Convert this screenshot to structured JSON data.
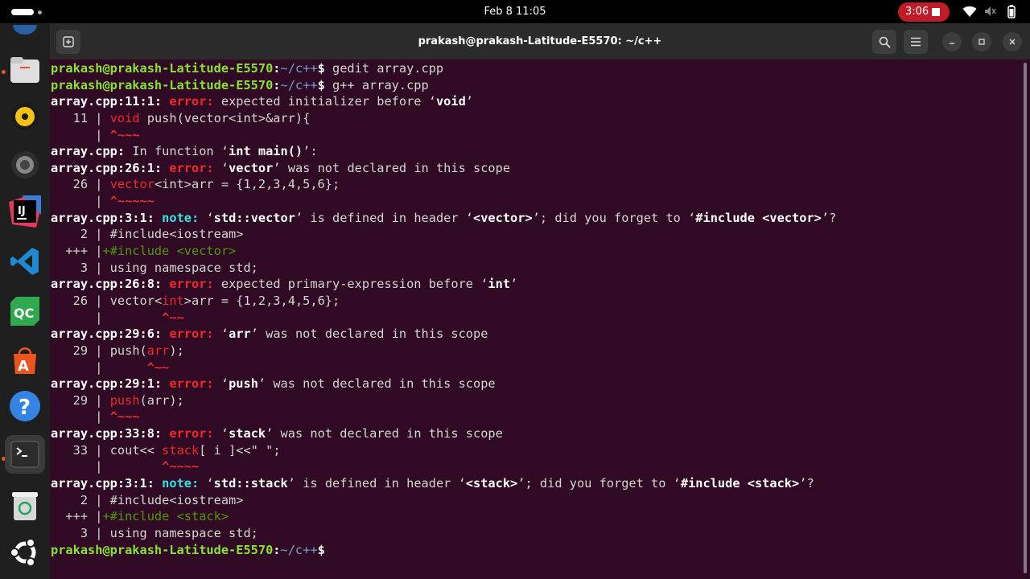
{
  "topbar": {
    "datetime": "Feb 8  11:05",
    "recording_time": "3:06"
  },
  "dock": {
    "items": [
      "files",
      "rhythmbox",
      "settings",
      "intellij",
      "vscode",
      "qt-creator",
      "app-center",
      "help",
      "terminal",
      "trash",
      "ubuntu-apps"
    ]
  },
  "window": {
    "title": "prakash@prakash-Latitude-E5570: ~/c++"
  },
  "terminal": {
    "prompt_user": "prakash@prakash-Latitude-E5570",
    "prompt_path": "~/c++",
    "cmd1": "gedit array.cpp",
    "cmd2": "g++ array.cpp",
    "lines": {
      "l3_loc": "array.cpp:11:1:",
      "l3_kind": "error:",
      "l3_msg_a": "expected initializer before ‘",
      "l3_tok": "void",
      "l3_msg_b": "’",
      "l4_num": "   11 | ",
      "l4_kw": "void",
      "l4_rest": " push(vector<int>&arr){",
      "l5_bar": "      | ",
      "l5_caret": "^~~~",
      "l6_a": "array.cpp:",
      "l6_b": " In function ‘",
      "l6_tok": "int main()",
      "l6_c": "’:",
      "l7_loc": "array.cpp:26:1:",
      "l7_kind": "error:",
      "l7_a": "‘",
      "l7_tok": "vector",
      "l7_b": "’ was not declared in this scope",
      "l8_num": "   26 | ",
      "l8_kw": "vector",
      "l8_rest": "<int>arr = {1,2,3,4,5,6};",
      "l9_bar": "      | ",
      "l9_caret": "^~~~~~",
      "l10_loc": "array.cpp:3:1:",
      "l10_kind": "note:",
      "l10_a": "‘",
      "l10_tok1": "std::vector",
      "l10_b": "’ is defined in header ‘",
      "l10_tok2": "<vector>",
      "l10_c": "’; did you forget to ‘",
      "l10_tok3": "#include <vector>",
      "l10_d": "’?",
      "l11": "    2 | #include<iostream>",
      "l12_num": "  +++ |",
      "l12_plus": "+#include <vector>",
      "l13": "    3 | using namespace std;",
      "l14_loc": "array.cpp:26:8:",
      "l14_kind": "error:",
      "l14_a": "expected primary-expression before ‘",
      "l14_tok": "int",
      "l14_b": "’",
      "l15_num": "   26 | ",
      "l15_a": "vector<",
      "l15_kw": "int",
      "l15_b": ">arr = {1,2,3,4,5,6};",
      "l16_bar": "      | ",
      "l16_sp": "       ",
      "l16_caret": "^~~",
      "l17_loc": "array.cpp:29:6:",
      "l17_kind": "error:",
      "l17_a": "‘",
      "l17_tok": "arr",
      "l17_b": "’ was not declared in this scope",
      "l18_num": "   29 | ",
      "l18_a": "push(",
      "l18_kw": "arr",
      "l18_b": ");",
      "l19_bar": "      | ",
      "l19_sp": "     ",
      "l19_caret": "^~~",
      "l20_loc": "array.cpp:29:1:",
      "l20_kind": "error:",
      "l20_a": "‘",
      "l20_tok": "push",
      "l20_b": "’ was not declared in this scope",
      "l21_num": "   29 | ",
      "l21_kw": "push",
      "l21_rest": "(arr);",
      "l22_bar": "      | ",
      "l22_caret": "^~~~",
      "l23_loc": "array.cpp:33:8:",
      "l23_kind": "error:",
      "l23_a": "‘",
      "l23_tok": "stack",
      "l23_b": "’ was not declared in this scope",
      "l24_num": "   33 | ",
      "l24_a": "cout<< ",
      "l24_kw": "stack",
      "l24_b": "[ i ]<<\" \";",
      "l25_bar": "      | ",
      "l25_sp": "       ",
      "l25_caret": "^~~~~",
      "l26_loc": "array.cpp:3:1:",
      "l26_kind": "note:",
      "l26_a": "‘",
      "l26_tok1": "std::stack",
      "l26_b": "’ is defined in header ‘",
      "l26_tok2": "<stack>",
      "l26_c": "’; did you forget to ‘",
      "l26_tok3": "#include <stack>",
      "l26_d": "’?",
      "l27": "    2 | #include<iostream>",
      "l28_num": "  +++ |",
      "l28_plus": "+#include <stack>",
      "l29": "    3 | using namespace std;"
    }
  }
}
